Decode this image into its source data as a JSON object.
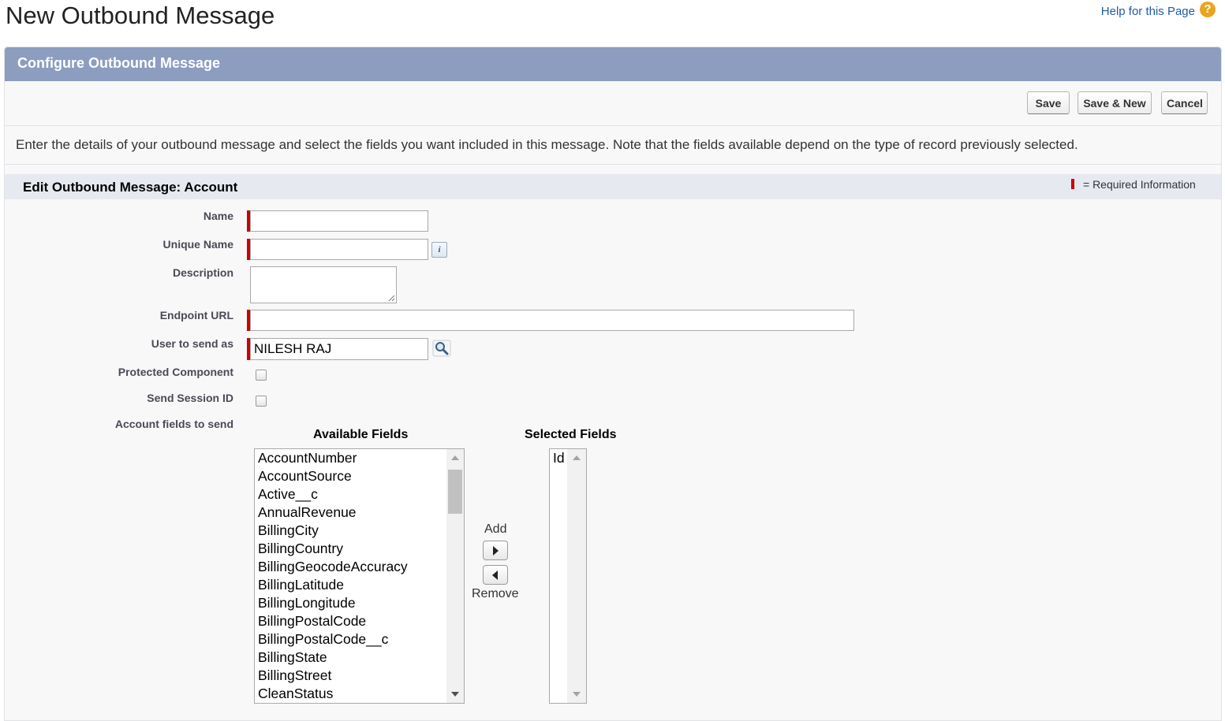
{
  "page": {
    "title": "New Outbound Message",
    "help_link": "Help for this Page",
    "help_icon": "?"
  },
  "panel": {
    "title": "Configure Outbound Message"
  },
  "buttons": {
    "save": "Save",
    "save_new": "Save & New",
    "cancel": "Cancel"
  },
  "instructions": "Enter the details of your outbound message and select the fields you want included in this message. Note that the fields available depend on the type of record previously selected.",
  "section": {
    "title": "Edit Outbound Message: Account",
    "required_legend": "= Required Information",
    "required_color": "#cc0000"
  },
  "form": {
    "name": {
      "label": "Name",
      "value": ""
    },
    "unique_name": {
      "label": "Unique Name",
      "value": ""
    },
    "description": {
      "label": "Description",
      "value": ""
    },
    "endpoint_url": {
      "label": "Endpoint URL",
      "value": ""
    },
    "user_to_send_as": {
      "label": "User to send as",
      "value": "NILESH RAJ"
    },
    "protected_component": {
      "label": "Protected Component",
      "checked": false
    },
    "send_session_id": {
      "label": "Send Session ID",
      "checked": false
    },
    "fields_to_send": {
      "label": "Account fields to send"
    }
  },
  "available_fields": {
    "heading": "Available Fields",
    "options": [
      "AccountNumber",
      "AccountSource",
      "Active__c",
      "AnnualRevenue",
      "BillingCity",
      "BillingCountry",
      "BillingGeocodeAccuracy",
      "BillingLatitude",
      "BillingLongitude",
      "BillingPostalCode",
      "BillingPostalCode__c",
      "BillingState",
      "BillingStreet",
      "CleanStatus"
    ]
  },
  "selected_fields": {
    "heading": "Selected Fields",
    "options": [
      "Id"
    ]
  },
  "mover": {
    "add": "Add",
    "remove": "Remove"
  },
  "icons": {
    "info": "info-icon",
    "lookup": "lookup-icon",
    "help": "help-icon"
  }
}
